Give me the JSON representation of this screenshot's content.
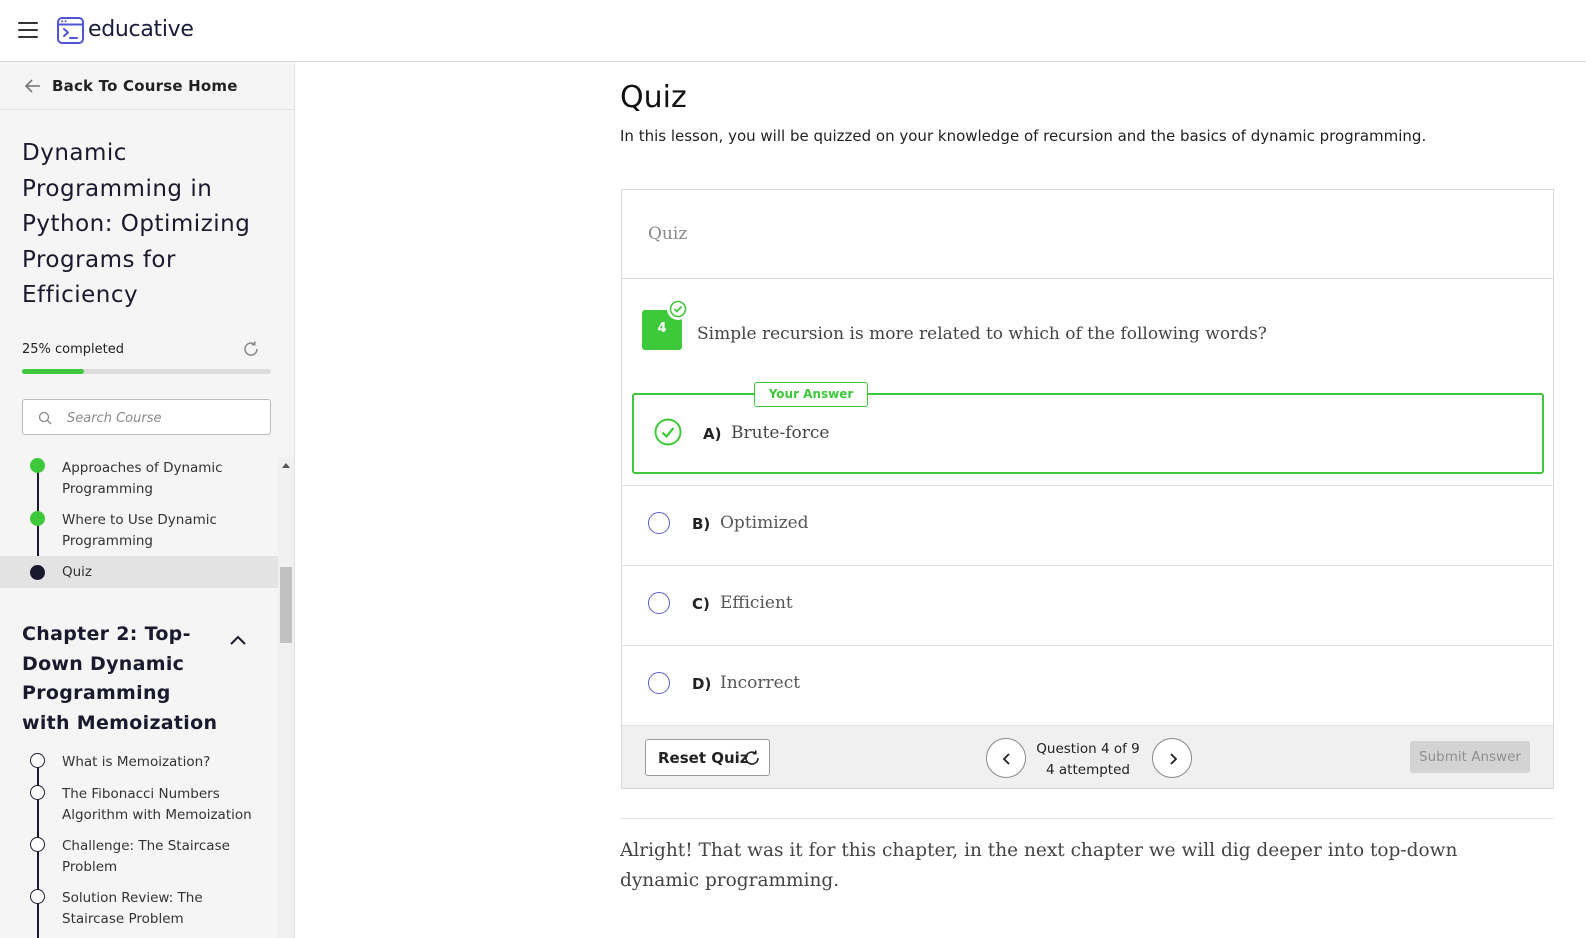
{
  "brand": {
    "name": "educative"
  },
  "sidebar": {
    "back_label": "Back To Course Home",
    "course_title": "Dynamic Programming in Python: Optimizing Programs for Efficiency",
    "progress_label": "25% completed",
    "progress_fraction": 0.25,
    "search_placeholder": "Search Course",
    "lessons": [
      {
        "label": "Approaches of Dynamic Programming",
        "state": "completed"
      },
      {
        "label": "Where to Use Dynamic Programming",
        "state": "completed"
      },
      {
        "label": "Quiz",
        "state": "current"
      }
    ],
    "chapter_2": {
      "title": "Chapter 2: Top-Down Dynamic Programming with Memoization",
      "lessons": [
        {
          "label": "What is Memoization?",
          "state": "not-started"
        },
        {
          "label": "The Fibonacci Numbers Algorithm with Memoization",
          "state": "not-started"
        },
        {
          "label": "Challenge: The Staircase Problem",
          "state": "not-started"
        },
        {
          "label": "Solution Review: The Staircase Problem",
          "state": "not-started"
        }
      ]
    }
  },
  "main": {
    "title": "Quiz",
    "intro": "In this lesson, you will be quizzed on your knowledge of recursion and the basics of dynamic programming.",
    "quiz": {
      "header": "Quiz",
      "question_number": "4",
      "question": "Simple recursion is more related to which of the following words?",
      "your_answer_label": "Your Answer",
      "options": [
        {
          "letter": "A)",
          "text": "Brute-force",
          "selected": true
        },
        {
          "letter": "B)",
          "text": "Optimized",
          "selected": false
        },
        {
          "letter": "C)",
          "text": "Efficient",
          "selected": false
        },
        {
          "letter": "D)",
          "text": "Incorrect",
          "selected": false
        }
      ],
      "reset_label": "Reset Quiz",
      "counter_line1": "Question 4 of 9",
      "counter_line2": "4 attempted",
      "submit_label": "Submit Answer"
    },
    "closing_text": "Alright! That was it for this chapter, in the next chapter we will dig deeper into top-down dynamic programming."
  },
  "colors": {
    "accent_green": "#3ec93a",
    "radio_purple": "#5b5fd6",
    "brand_navy": "#1b1b3a"
  }
}
